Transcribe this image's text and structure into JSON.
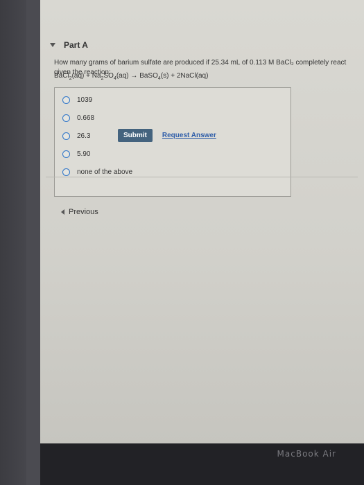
{
  "part": {
    "title": "Part A"
  },
  "question": {
    "text": "How many grams of barium sulfate are produced if 25.34 mL of 0.113 M BaCl₂ completely react given the reaction:"
  },
  "reaction": {
    "reactant1": "BaCl",
    "reactant1_sub": "2",
    "reactant1_state": "(aq) + ",
    "reactant2": "Na",
    "reactant2_sub1": "2",
    "reactant2_mid": "SO",
    "reactant2_sub2": "4",
    "reactant2_state": "(aq) → ",
    "product1": "BaSO",
    "product1_sub": "4",
    "product1_state": "(s) + 2NaCl(aq)"
  },
  "choices": [
    {
      "label": "1039"
    },
    {
      "label": "0.668"
    },
    {
      "label": "26.3"
    },
    {
      "label": "5.90"
    },
    {
      "label": "none of the above"
    }
  ],
  "actions": {
    "submit_label": "Submit",
    "request_answer_label": "Request Answer"
  },
  "nav": {
    "previous_label": "Previous"
  },
  "device": {
    "brand": "MacBook Air"
  }
}
